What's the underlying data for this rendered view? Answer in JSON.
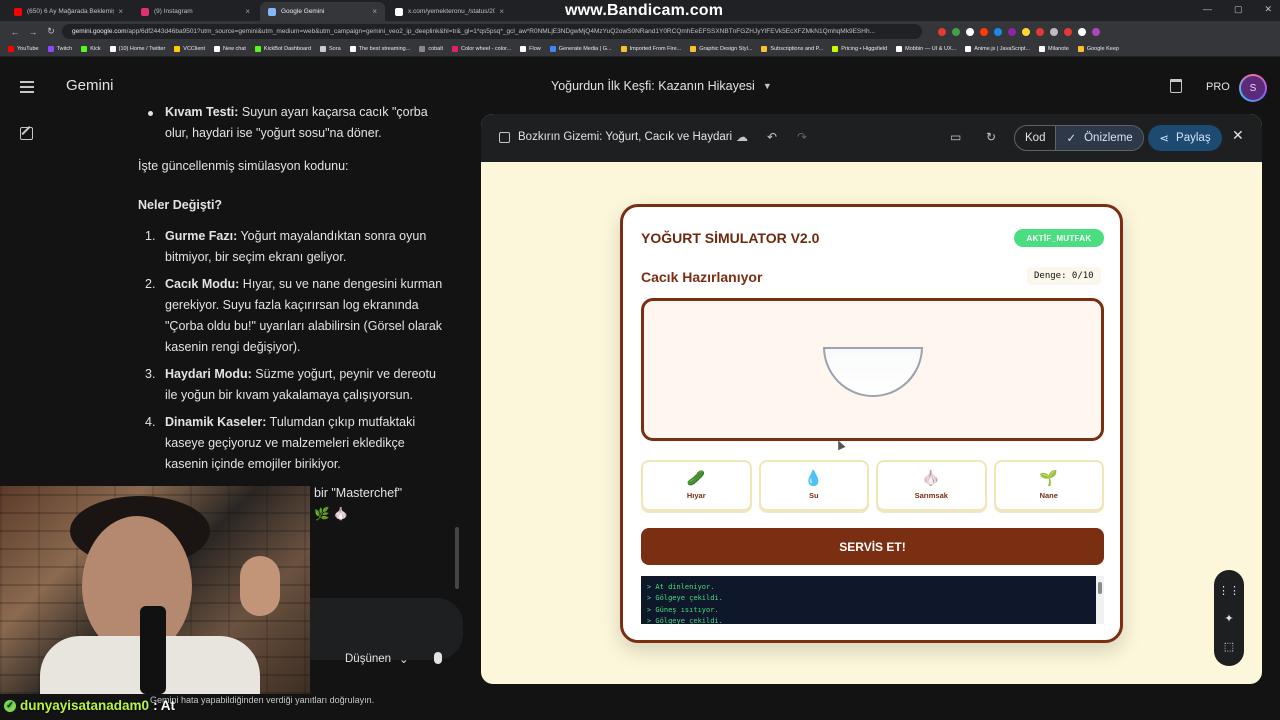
{
  "browser": {
    "tabs": [
      {
        "title": "(650) 6 Ay Mağarada Beklemiş",
        "color": "#ff0000",
        "active": false
      },
      {
        "title": "(9) Instagram",
        "color": "#e1306c",
        "active": false
      },
      {
        "title": "Google Gemini",
        "color": "#8ab4f8",
        "active": true
      },
      {
        "title": "x.com/yemekteronu_/status/20...",
        "color": "#ffffff",
        "active": false
      }
    ],
    "watermark": "www.Bandicam.com",
    "url_host": "gemini.google.com",
    "url_rest": "/app/6df2443d46ba9501?utm_source=gemini&utm_medium=web&utm_campaign=gemini_veo2_ip_deeplink&hl=tr&_gl=1*qs5psq*_gcl_aw*R0NMLjE3NDgwMjQ4MzYuQ2owS0NRand1Y0RCQmhEeEFSSXNBTnFGZHJyYlFEVk5EcXFZMkN1QmhqMk9ESHh...",
    "bookmarks": [
      "YouTube",
      "Twitch",
      "Kick",
      "(10) Home / Twitter",
      "VCClient",
      "New chat",
      "KickBot Dashboard",
      "Sora",
      "The best streaming...",
      "cobalt",
      "Color wheel - color...",
      "Flow",
      "Generate Media | G...",
      "Imported From Fire...",
      "Graphic Design Styl...",
      "Subscriptions and P...",
      "Pricing • Higgsfield",
      "Mobbin — UI & UX...",
      "Anime.js | JavaScript...",
      "Milanote",
      "Google Keep"
    ]
  },
  "gemini": {
    "brand": "Gemini",
    "conversation_title": "Yoğurdun İlk Keşfi: Kazanın Hikayesi",
    "pro_label": "PRO",
    "avatar_initial": "S"
  },
  "chat": {
    "bullet_bold": "Kıvam Testi:",
    "bullet_text": " Suyun ayarı kaçarsa cacık \"çorba olur, haydari ise \"yoğurt sosu\"na döner.",
    "intro": "İşte güncellenmiş simülasyon kodunu:",
    "heading": "Neler Değişti?",
    "items": [
      {
        "num": "1.",
        "bold": "Gurme Fazı:",
        "text": " Yoğurt mayalandıktan sonra oyun bitmiyor, bir seçim ekranı geliyor."
      },
      {
        "num": "2.",
        "bold": "Cacık Modu:",
        "text": " Hıyar, su ve nane dengesini kurman gerekiyor. Suyu fazla kaçırırsan log ekranında \"Çorba oldu bu!\" uyarıları alabilirsin (Görsel olarak kasenin rengi değişiyor)."
      },
      {
        "num": "3.",
        "bold": "Haydari Modu:",
        "text": " Süzme yoğurt, peynir ve dereotu ile yoğun bir kıvam yakalamaya çalışıyorsun."
      },
      {
        "num": "4.",
        "bold": "Dinamik Kaseler:",
        "text": " Tulumdan çıkıp mutfaktaki kaseye geçiyoruz ve malzemeleri ekledikçe kasenin içinde emojiler birikiyor."
      }
    ],
    "tail_text": "bir \"Masterchef\"",
    "tail_emoji": "🌿 🧄",
    "model_label": "Düşünen",
    "disclaimer_left": "Gemini hata yapabildiğinden verdiği yanıtları",
    "disclaimer_right": "doğrulayın."
  },
  "stream": {
    "username": "dunyayisatanadam0",
    "message": ": At"
  },
  "canvas": {
    "title": "Bozkırın Gizemi: Yoğurt, Cacık ve Haydari",
    "tab_code": "Kod",
    "tab_preview": "Önizleme",
    "share_label": "Paylaş"
  },
  "simulator": {
    "title": "YOĞURT SİMULATOR V2.0",
    "badge": "AKTİF_MUTFAK",
    "mode_title": "Cacık Hazırlanıyor",
    "balance_label": "Denge: 0/10",
    "ingredients": [
      {
        "emoji": "🥒",
        "label": "Hıyar"
      },
      {
        "emoji": "💧",
        "label": "Su"
      },
      {
        "emoji": "🧄",
        "label": "Sarımsak"
      },
      {
        "emoji": "🌱",
        "label": "Nane"
      }
    ],
    "serve_label": "SERVİS ET!",
    "log": [
      "> At dinleniyor.",
      "> Gölgeye çekildi.",
      "> Güneş ısıtıyor.",
      "> Gölgeye çekildi."
    ]
  },
  "colors": {
    "accent_brown": "#7a2e12",
    "badge_green": "#4ade80",
    "canvas_bg": "#fcf6da",
    "log_green": "#4ade80"
  }
}
